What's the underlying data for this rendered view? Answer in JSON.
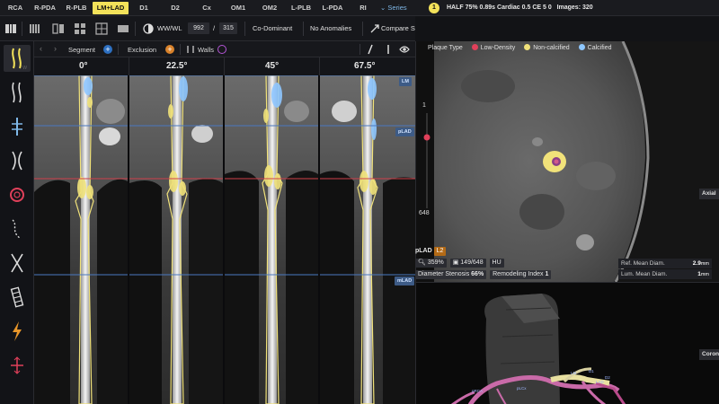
{
  "vessel_tabs": [
    "RCA",
    "R-PDA",
    "R-PLB",
    "LM+LAD",
    "D1",
    "D2",
    "Cx",
    "OM1",
    "OM2",
    "L-PLB",
    "L-PDA",
    "RI"
  ],
  "active_tab": "LM+LAD",
  "series_label": "Series",
  "series_badge": "1",
  "study_info": "HALF 75% 0.89s Cardiac 0.5 CE 5 0",
  "images_info": "Images: 320",
  "toolbar": {
    "wwwl_label": "WW/WL",
    "ww_value": "992",
    "wl_sep": "/",
    "wl_value": "315",
    "dominance": "Co-Dominant",
    "anomalies": "No Anomalies",
    "compare": "Compare Study"
  },
  "segment_row": {
    "segment": "Segment",
    "exclusion": "Exclusion",
    "walls": "Walls"
  },
  "angles": [
    "0°",
    "22.5°",
    "45°",
    "67.5°"
  ],
  "cpr_tags": {
    "lm": "LM",
    "plad": "pLAD",
    "mlad": "mLAD"
  },
  "legend": {
    "title": "Plaque Type",
    "items": [
      {
        "label": "Low-Density",
        "color": "#e0405a"
      },
      {
        "label": "Non-calcified",
        "color": "#f1e27a"
      },
      {
        "label": "Calcified",
        "color": "#8ec7ff"
      }
    ]
  },
  "slice": {
    "top": "1",
    "bottom": "648"
  },
  "axial_label": "Axial",
  "coronal_label": "Coron",
  "measurements": {
    "segment": "pLAD",
    "segment_tag": "L2",
    "zoom": "359%",
    "slice_pos": "149/648",
    "unit": "HU",
    "stenosis_label": "Diameter Stenosis",
    "stenosis_value": "66%",
    "remodel_label": "Remodeling Index",
    "remodel_value": "1",
    "ref_label": "Ref. Mean Diam.",
    "ref_value": "2.9",
    "ref_unit": "mm",
    "lum_label": "Lum. Mean Diam.",
    "lum_value": "1",
    "lum_unit": "mm"
  },
  "sidebar_keys": [
    "W",
    "",
    "",
    "",
    "",
    "",
    "",
    "",
    "",
    ""
  ],
  "coronal_segment_labels": [
    "LM",
    "LAD",
    "D1",
    "pLCx",
    "pRCA",
    "D2"
  ]
}
